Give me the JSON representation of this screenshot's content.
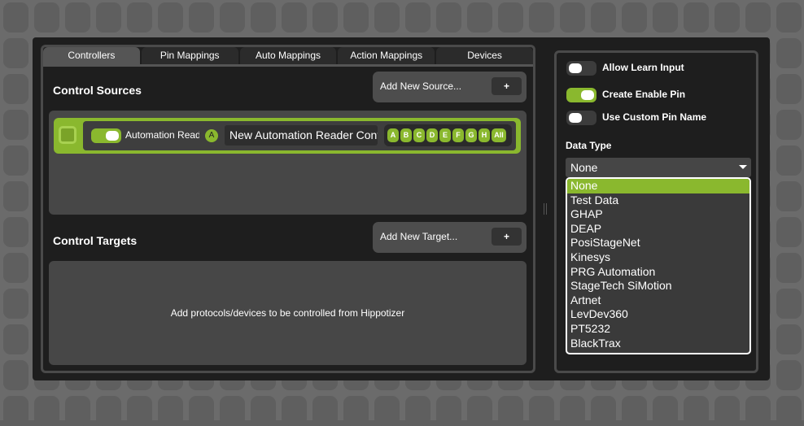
{
  "tabs": [
    "Controllers",
    "Pin Mappings",
    "Auto Mappings",
    "Action Mappings",
    "Devices"
  ],
  "sources": {
    "title": "Control Sources",
    "add_label": "Add New Source...",
    "add_button": "+",
    "row": {
      "enabled": true,
      "type_label": "Automation Reader",
      "badge": "A",
      "name": "New Automation Reader Controller",
      "letters": [
        "A",
        "B",
        "C",
        "D",
        "E",
        "F",
        "G",
        "H",
        "All"
      ]
    }
  },
  "targets": {
    "title": "Control Targets",
    "add_label": "Add New Target...",
    "add_button": "+",
    "empty_text": "Add protocols/devices to be controlled from Hippotizer"
  },
  "settings": {
    "allow_learn": {
      "label": "Allow Learn Input",
      "on": false
    },
    "create_enable": {
      "label": "Create Enable Pin",
      "on": true
    },
    "custom_name": {
      "label": "Use Custom Pin Name",
      "on": false
    },
    "data_type_label": "Data Type",
    "data_type_value": "None",
    "options": [
      "None",
      "Test Data",
      "GHAP",
      "DEAP",
      "PosiStageNet",
      "Kinesys",
      "PRG Automation",
      "StageTech SiMotion",
      "Artnet",
      "LevDev360",
      "PT5232",
      "BlackTrax"
    ]
  },
  "colors": {
    "accent": "#8ab82e"
  }
}
